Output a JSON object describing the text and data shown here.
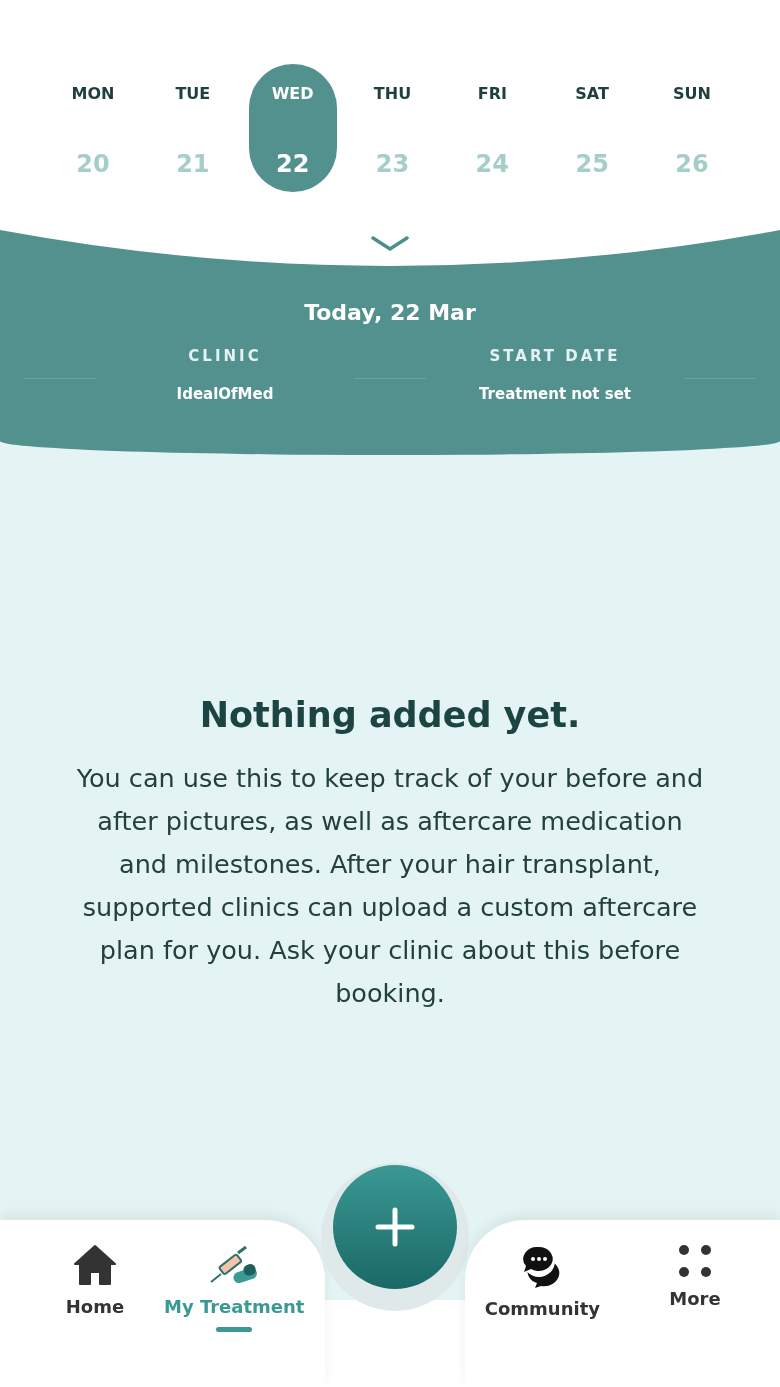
{
  "week": [
    {
      "day": "MON",
      "date": "20",
      "selected": false
    },
    {
      "day": "TUE",
      "date": "21",
      "selected": false
    },
    {
      "day": "WED",
      "date": "22",
      "selected": true
    },
    {
      "day": "THU",
      "date": "23",
      "selected": false
    },
    {
      "day": "FRI",
      "date": "24",
      "selected": false
    },
    {
      "day": "SAT",
      "date": "25",
      "selected": false
    },
    {
      "day": "SUN",
      "date": "26",
      "selected": false
    }
  ],
  "summary": {
    "title": "Today, 22 Mar",
    "fields": [
      {
        "label": "CLINIC",
        "value": "IdealOfMed"
      },
      {
        "label": "START DATE",
        "value": "Treatment not set"
      }
    ]
  },
  "empty_state": {
    "title": "Nothing added yet.",
    "body": "You can use this to keep track of your before and after pictures, as well as aftercare medication and milestones. After your hair transplant, supported clinics can upload a custom aftercare plan for you. Ask your clinic about this before booking."
  },
  "nav": [
    {
      "kind": "home",
      "label": "Home",
      "selected": false
    },
    {
      "kind": "treatment",
      "label": "My Treatment",
      "selected": true
    },
    {
      "kind": "community",
      "label": "Community",
      "selected": false
    },
    {
      "kind": "more",
      "label": "More",
      "selected": false
    }
  ]
}
